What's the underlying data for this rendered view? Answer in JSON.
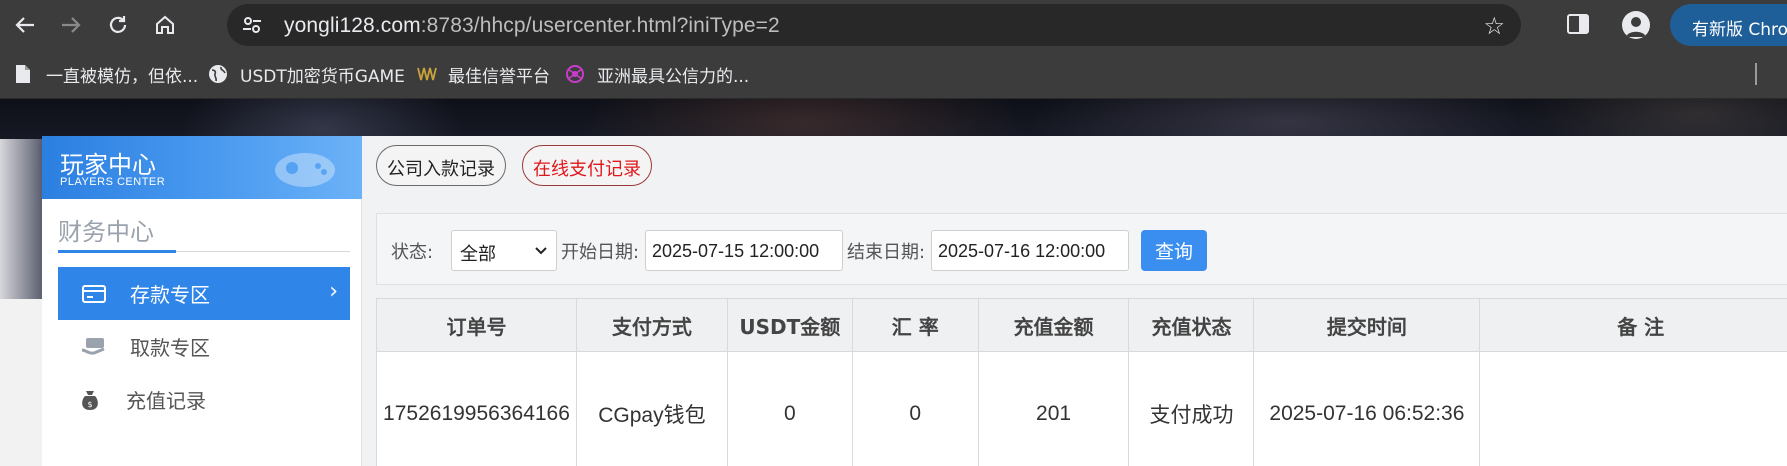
{
  "browser": {
    "url_host": "yongli128.com",
    "url_rest": ":8783/hhcp/usercenter.html?iniType=2",
    "update_button_label": "有新版 Chrome",
    "bookmarks": [
      {
        "label": "一直被模仿，但依...",
        "icon": "page-icon"
      },
      {
        "label": "USDT加密货币GAME",
        "icon": "globe-icon"
      },
      {
        "label": "最佳信誉平台",
        "icon": "site-logo-icon"
      },
      {
        "label": "亚洲最具公信力的...",
        "icon": "molecule-icon"
      }
    ]
  },
  "sidebar": {
    "title": "玩家中心",
    "subtitle": "PLAYERS CENTER",
    "section_title": "财务中心",
    "items": [
      {
        "label": "存款专区",
        "icon": "card-icon",
        "active": true
      },
      {
        "label": "取款专区",
        "icon": "cash-icon",
        "active": false
      },
      {
        "label": "充值记录",
        "icon": "moneybag-icon",
        "active": false
      }
    ]
  },
  "tabs": [
    {
      "label": "公司入款记录",
      "active": false
    },
    {
      "label": "在线支付记录",
      "active": true
    }
  ],
  "filter": {
    "status_label": "状态:",
    "status_value": "全部",
    "start_label": "开始日期:",
    "start_value": "2025-07-15 12:00:00",
    "end_label": "结束日期:",
    "end_value": "2025-07-16 12:00:00",
    "query_label": "查询"
  },
  "table": {
    "headers": [
      "订单号",
      "支付方式",
      "USDT金额",
      "汇 率",
      "充值金额",
      "充值状态",
      "提交时间",
      "备 注"
    ],
    "rows": [
      [
        "1752619956364166",
        "CGpay钱包",
        "0",
        "0",
        "201",
        "支付成功",
        "2025-07-16 06:52:36",
        ""
      ]
    ]
  },
  "colors": {
    "accent": "#2f86e8",
    "tab_active_text": "#e0161b",
    "query_button": "#3a8ef0"
  }
}
